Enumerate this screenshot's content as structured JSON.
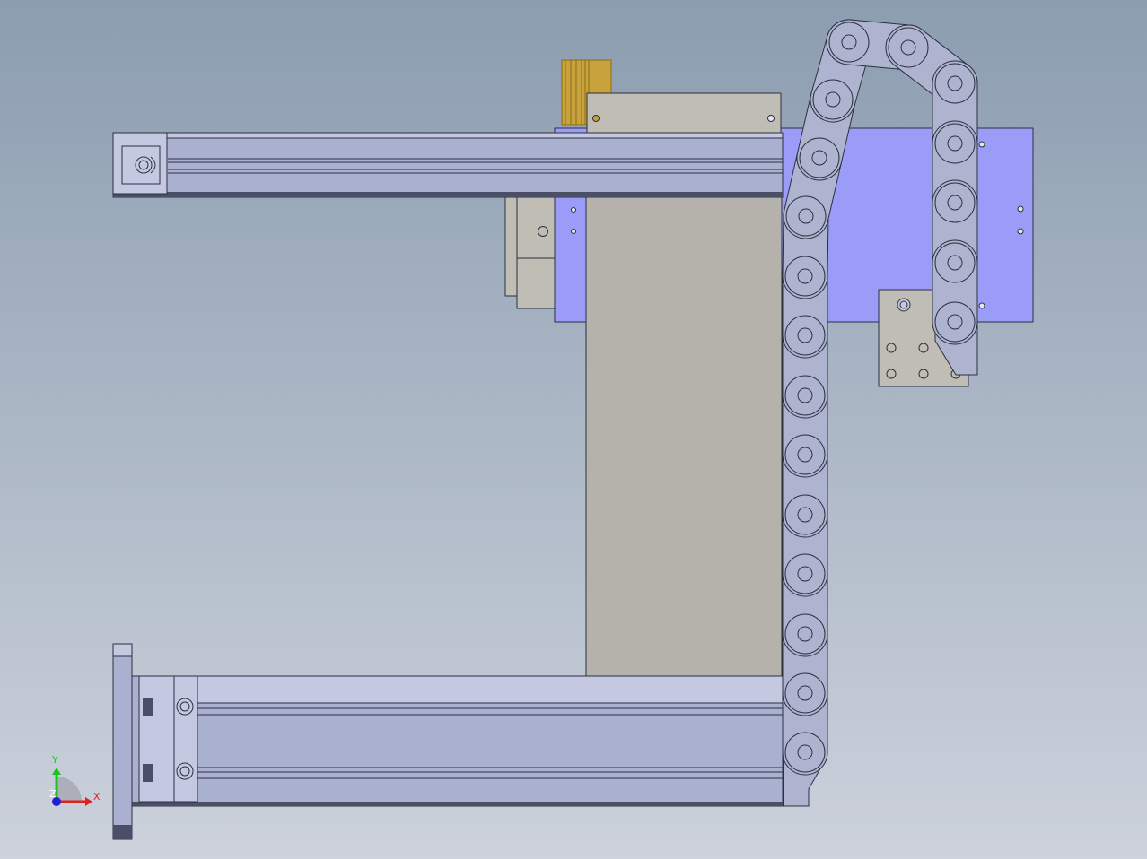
{
  "viewport": {
    "background_top": "#8b9db0",
    "background_bottom": "#cdd2dc"
  },
  "colors": {
    "rail": "#aab0d0",
    "rail_light": "#c4c8e0",
    "rail_dark": "#4a4e66",
    "plate_gray": "#b4b2ab",
    "plate_gray_light": "#c0bdb5",
    "plate_blue": "#9a9cf7",
    "motor_gold": "#c8a23c",
    "motor_gold_dark": "#8d6e18",
    "chain": "#aeb3cf",
    "edge": "#2d3040"
  },
  "cable_chain": {
    "link_count": 15
  },
  "triad": {
    "x_label": "X",
    "y_label": "Y",
    "z_label": "Z",
    "x_color": "#e02020",
    "y_color": "#20c020",
    "z_color": "#2020d0"
  }
}
